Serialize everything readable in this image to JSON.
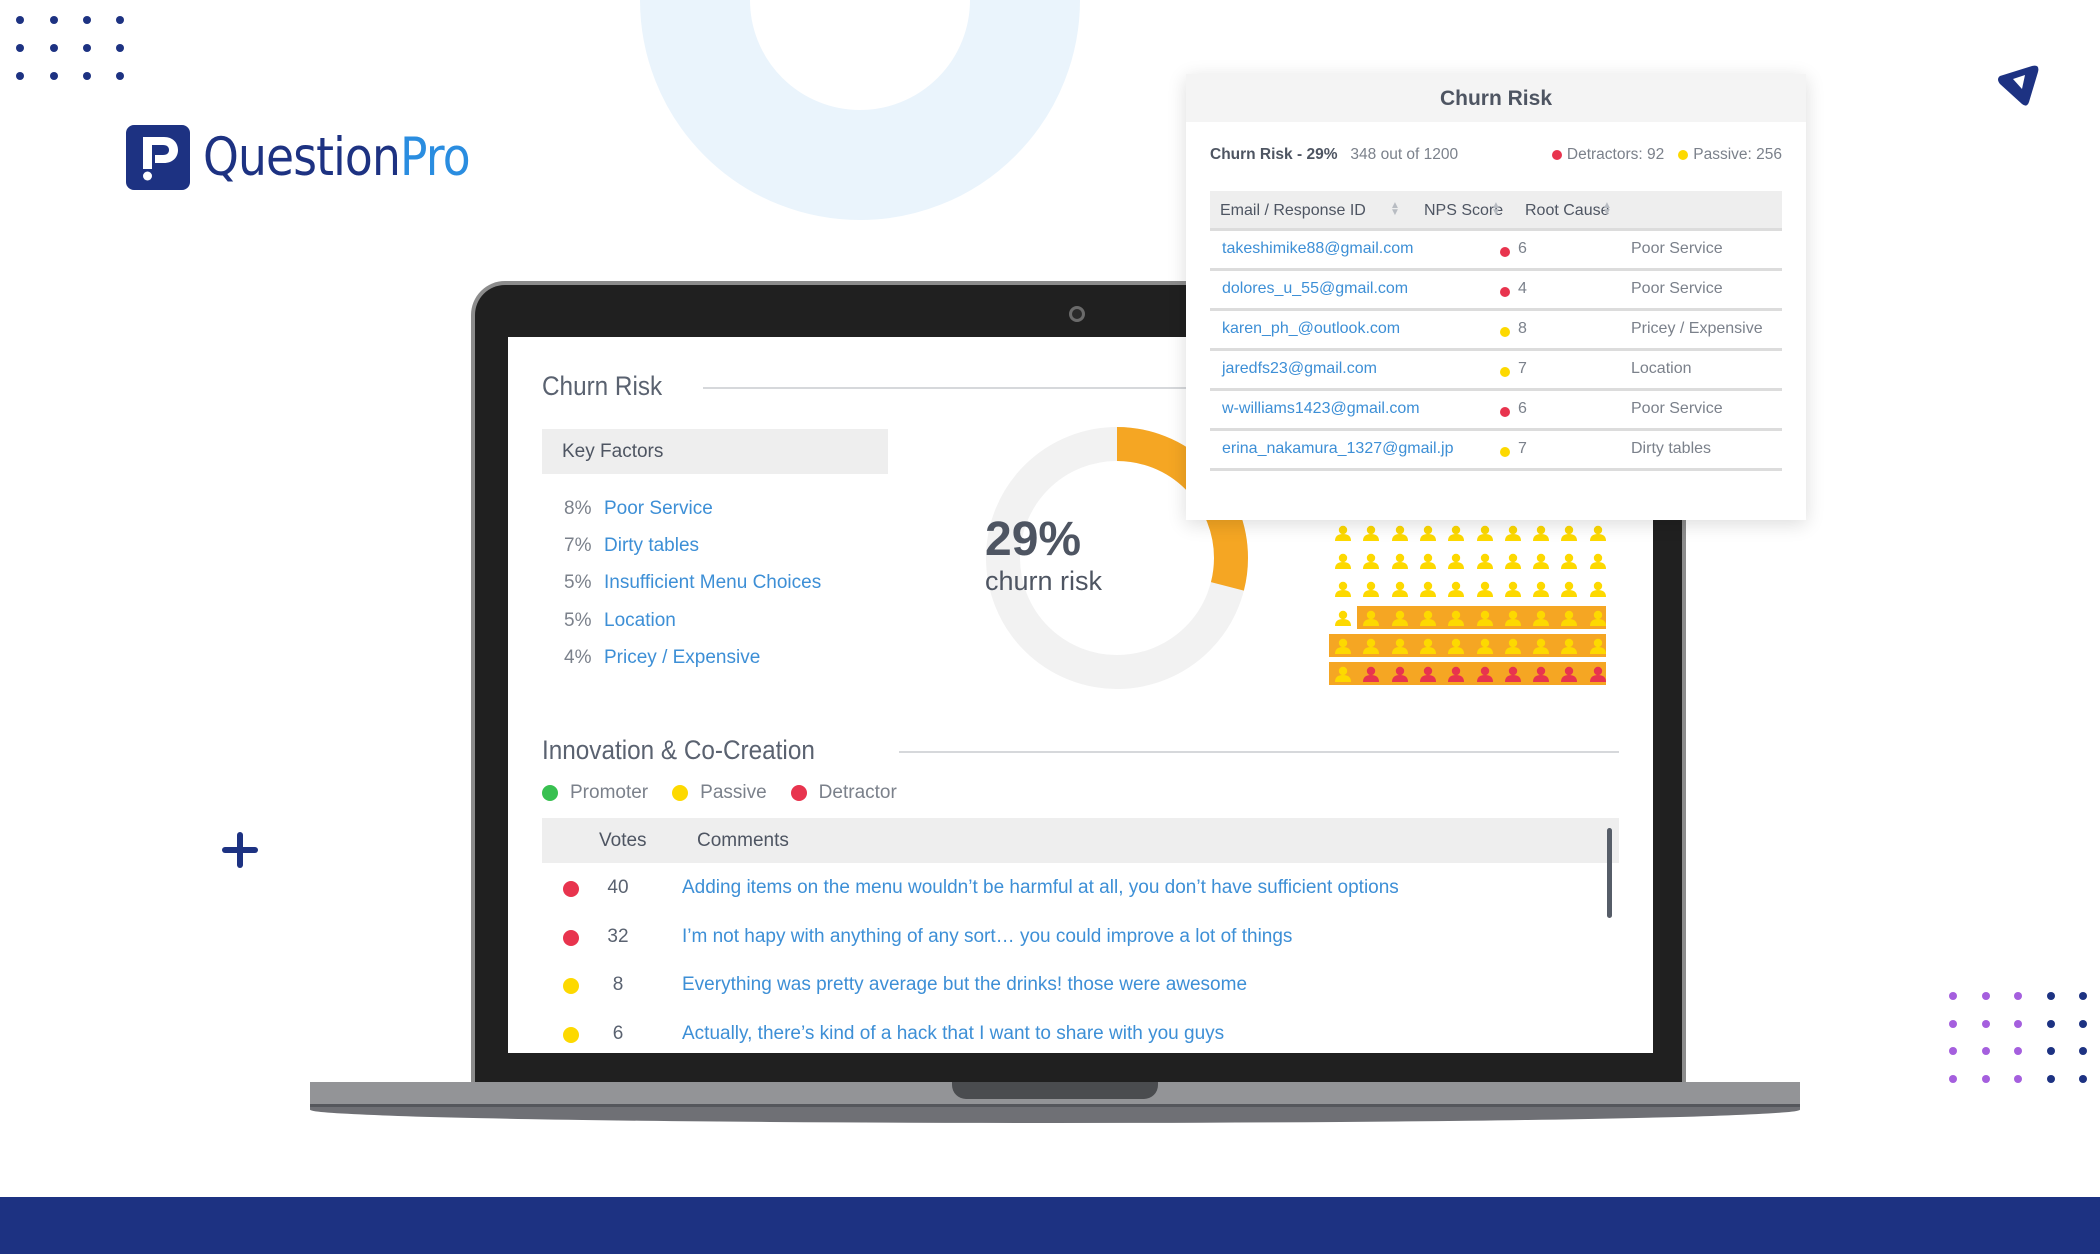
{
  "brand": {
    "name_part1": "Question",
    "name_part2": "Pro",
    "colors": {
      "navy": "#1d3282",
      "blue": "#2a8de0",
      "purple": "#a55fde",
      "ring": "#eaf4fc"
    }
  },
  "icons": {
    "logo": "questionpro-logo-icon",
    "top_right": "send-triangle-icon",
    "plus": "plus-icon",
    "camera": "camera-icon"
  },
  "colors": {
    "detractor": "#e8344e",
    "passive": "#fdd900",
    "promoter": "#38c050",
    "highlight": "#f5a623",
    "link": "#3d8fd6",
    "text": "#5a6270"
  },
  "dashboard": {
    "churn": {
      "title": "Churn Risk",
      "key_factors_label": "Key Factors",
      "key_factors": [
        {
          "pct": "8%",
          "label": "Poor Service"
        },
        {
          "pct": "7%",
          "label": "Dirty tables"
        },
        {
          "pct": "5%",
          "label": "Insufficient Menu Choices"
        },
        {
          "pct": "5%",
          "label": "Location"
        },
        {
          "pct": "4%",
          "label": "Pricey / Expensive"
        }
      ],
      "donut": {
        "value_pct": 29,
        "label": "29%",
        "sub_label": "churn risk"
      },
      "people_grid": {
        "total": 60,
        "columns": 10,
        "passive_count": 51,
        "detractor_count": 9,
        "highlighted_count": 29
      }
    },
    "innovation": {
      "title": "Innovation & Co-Creation",
      "legend": [
        {
          "label": "Promoter",
          "type": "promoter"
        },
        {
          "label": "Passive",
          "type": "passive"
        },
        {
          "label": "Detractor",
          "type": "detractor"
        }
      ],
      "columns": {
        "votes": "Votes",
        "comments": "Comments"
      },
      "rows": [
        {
          "type": "detractor",
          "votes": "40",
          "comment": "Adding items on the menu wouldn’t be harmful at all, you don’t have sufficient options"
        },
        {
          "type": "detractor",
          "votes": "32",
          "comment": "I’m not hapy with anything of any sort… you could improve a lot of things"
        },
        {
          "type": "passive",
          "votes": "8",
          "comment": "Everything was pretty average but the drinks! those were awesome"
        },
        {
          "type": "passive",
          "votes": "6",
          "comment": "Actually, there’s kind of a hack that I want to share with you guys"
        }
      ]
    }
  },
  "popup": {
    "title": "Churn Risk",
    "summary_label": "Churn Risk - 29%",
    "summary_count": "348 out of 1200",
    "detractors": "Detractors: 92",
    "passive": "Passive: 256",
    "columns": [
      "Email / Response ID",
      "NPS Score",
      "Root Cause"
    ],
    "rows": [
      {
        "email": "takeshimike88@gmail.com",
        "type": "detractor",
        "nps": "6",
        "cause": "Poor Service"
      },
      {
        "email": "dolores_u_55@gmail.com",
        "type": "detractor",
        "nps": "4",
        "cause": "Poor Service"
      },
      {
        "email": "karen_ph_@outlook.com",
        "type": "passive",
        "nps": "8",
        "cause": "Pricey / Expensive"
      },
      {
        "email": "jaredfs23@gmail.com",
        "type": "passive",
        "nps": "7",
        "cause": "Location"
      },
      {
        "email": "w-williams1423@gmail.com",
        "type": "detractor",
        "nps": "6",
        "cause": "Poor Service"
      },
      {
        "email": "erina_nakamura_1327@gmail.jp",
        "type": "passive",
        "nps": "7",
        "cause": "Dirty tables"
      }
    ]
  }
}
